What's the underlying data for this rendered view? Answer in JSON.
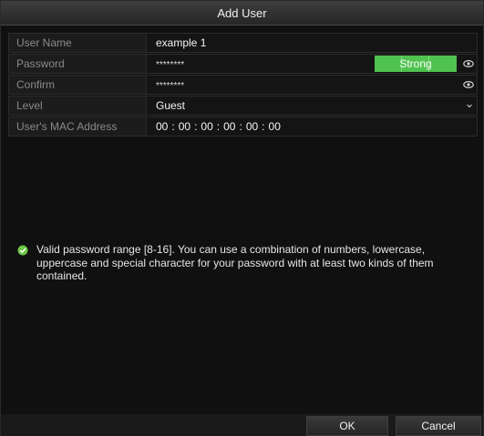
{
  "dialog": {
    "title": "Add User"
  },
  "form": {
    "user_name": {
      "label": "User Name",
      "value": "example 1"
    },
    "password": {
      "label": "Password",
      "value": "********",
      "strength": "Strong",
      "strength_color": "#4fc24f"
    },
    "confirm": {
      "label": "Confirm",
      "value": "********"
    },
    "level": {
      "label": "Level",
      "value": "Guest"
    },
    "mac": {
      "label": "User's MAC Address",
      "octets": [
        "00",
        "00",
        "00",
        "00",
        "00",
        "00"
      ]
    }
  },
  "hint": {
    "text": "Valid password range [8-16]. You can use a combination of numbers, lowercase, uppercase and special character for your password with at least two kinds of them contained.",
    "icon": "check-circle-icon",
    "icon_color": "#6cc644"
  },
  "buttons": {
    "ok": "OK",
    "cancel": "Cancel"
  }
}
